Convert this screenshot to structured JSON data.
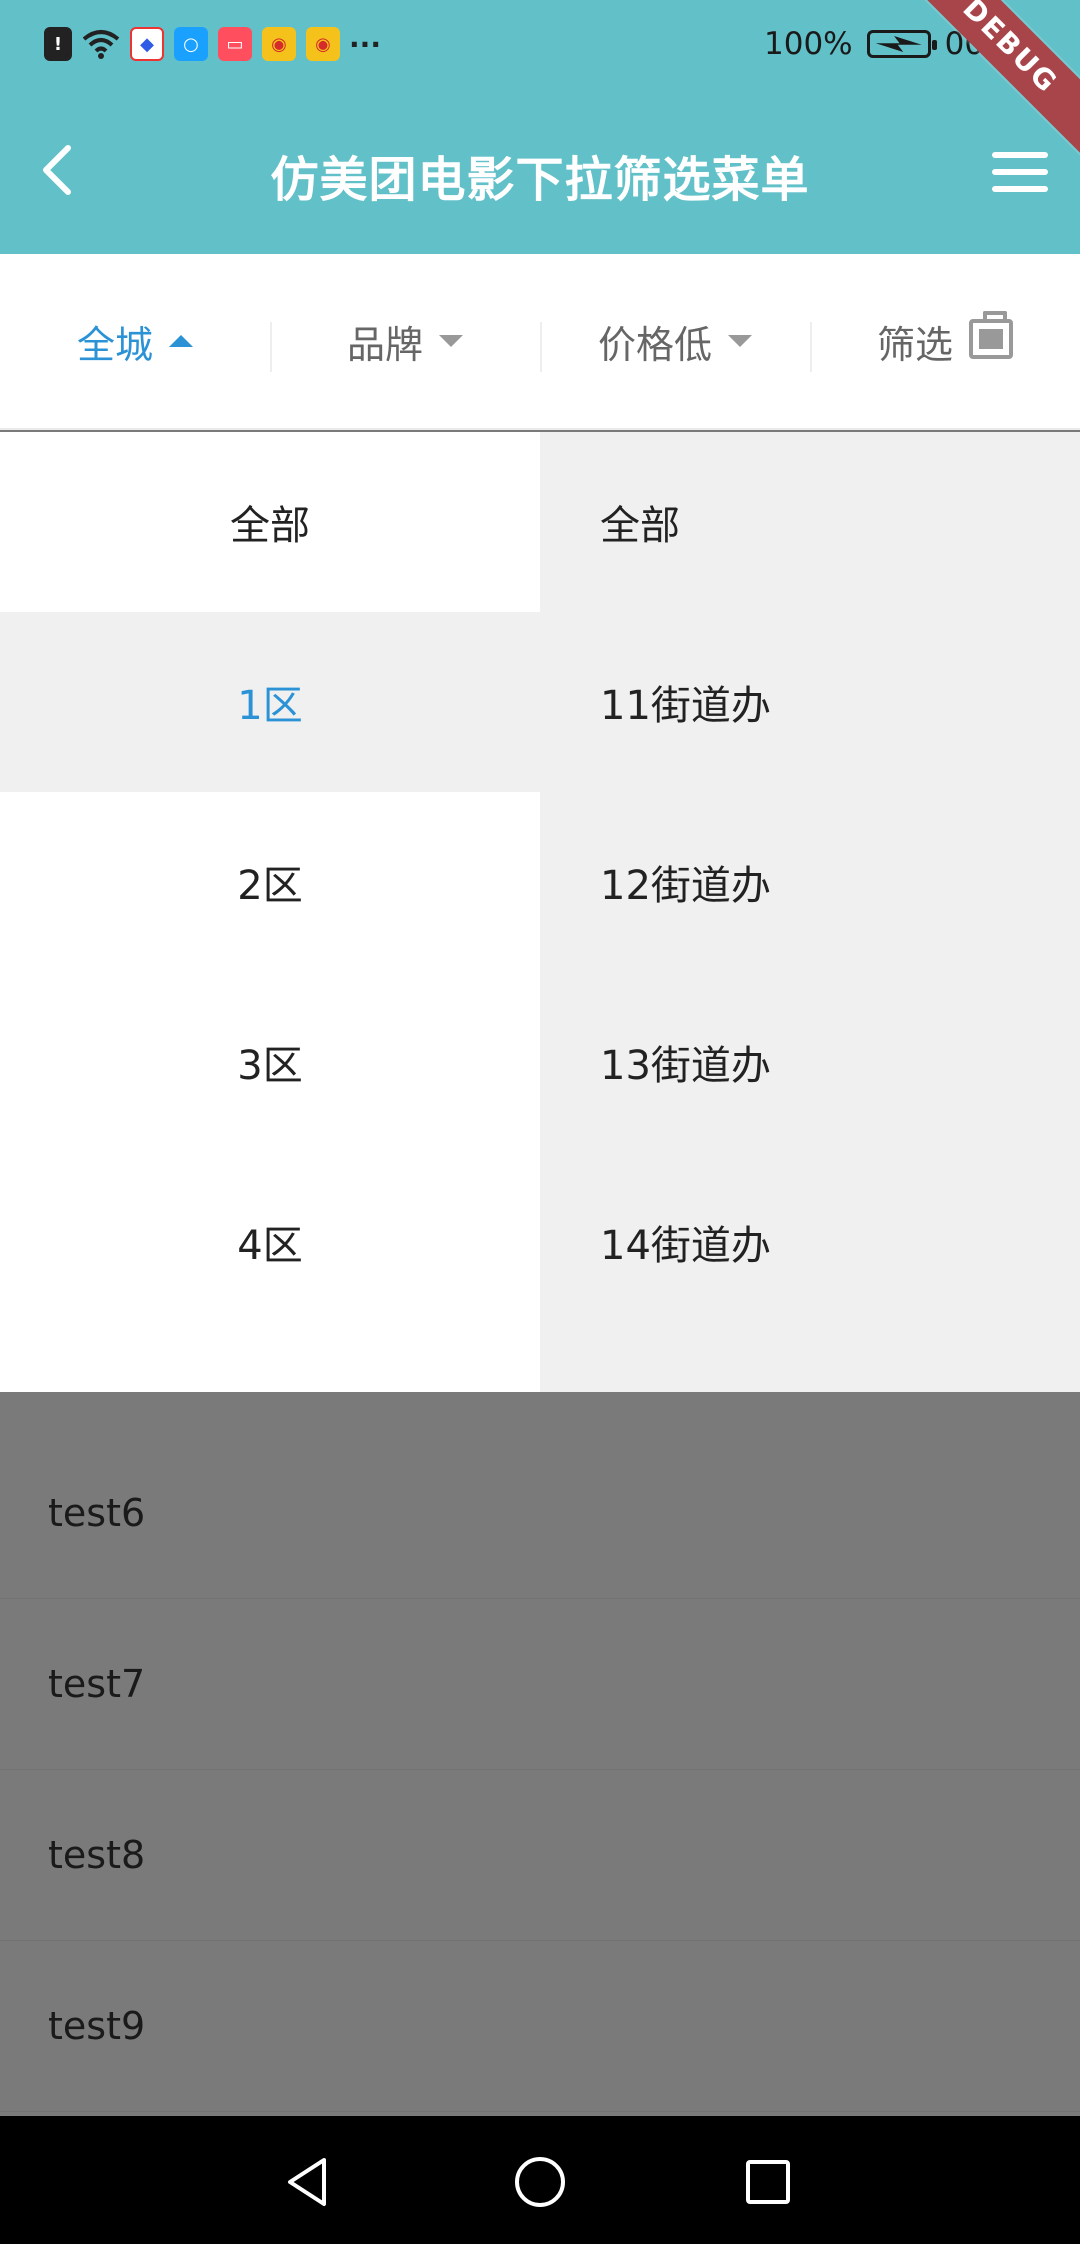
{
  "status_bar": {
    "battery": "100%",
    "time": "00:29",
    "notification_icons": [
      "alert-icon",
      "wifi-icon",
      "baidu-icon",
      "search-app-icon",
      "notes-app-icon",
      "weibo-icon",
      "weibo-icon"
    ],
    "more": "···"
  },
  "debug_banner": "DEBUG",
  "app_bar": {
    "title": "仿美团电影下拉筛选菜单",
    "back_icon": "chevron-left-icon",
    "menu_icon": "hamburger-menu-icon",
    "background_color": "#61c0c8"
  },
  "filter_bar": {
    "tabs": [
      {
        "label": "全城",
        "active": true,
        "icon": "caret-up-icon"
      },
      {
        "label": "品牌",
        "active": false,
        "icon": "caret-down-icon"
      },
      {
        "label": "价格低",
        "active": false,
        "icon": "caret-down-icon"
      },
      {
        "label": "筛选",
        "active": false,
        "icon": "filter-box-icon"
      }
    ],
    "active_color": "#2b92d6"
  },
  "dropdown": {
    "left_items": [
      {
        "label": "全部",
        "selected": false
      },
      {
        "label": "1区",
        "selected": true
      },
      {
        "label": "2区",
        "selected": false
      },
      {
        "label": "3区",
        "selected": false
      },
      {
        "label": "4区",
        "selected": false
      }
    ],
    "right_items": [
      "全部",
      "11街道办",
      "12街道办",
      "13街道办",
      "14街道办"
    ]
  },
  "list": {
    "items": [
      "test6",
      "test7",
      "test8",
      "test9"
    ]
  },
  "nav_bar": {
    "back_icon": "triangle-back-icon",
    "home_icon": "circle-home-icon",
    "recent_icon": "square-recent-icon"
  }
}
